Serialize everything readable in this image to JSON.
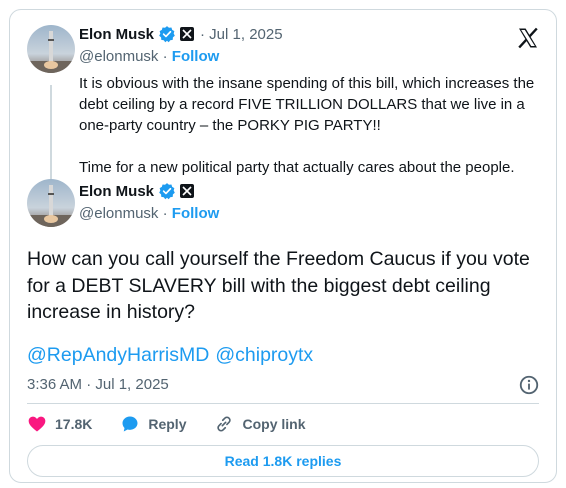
{
  "quoted_tweet": {
    "author_name": "Elon Musk",
    "date": "· Jul 1, 2025",
    "handle": "@elonmusk",
    "follow_sep": " · ",
    "follow_label": "Follow",
    "text": "It is obvious with the insane spending of this bill, which increases the debt ceiling by a record FIVE TRILLION DOLLARS that we live in a one-party country – the PORKY PIG PARTY!!\n\nTime for a new political party that actually cares about the people."
  },
  "main_tweet": {
    "author_name": "Elon Musk",
    "handle": "@elonmusk",
    "follow_sep": " · ",
    "follow_label": "Follow",
    "text": "How can you call yourself the Freedom Caucus if you vote for a DEBT SLAVERY bill with the biggest debt ceiling increase in history?",
    "mentions": [
      "@RepAndyHarrisMD",
      "@chiproytx"
    ],
    "timestamp": "3:36 AM · Jul 1, 2025"
  },
  "actions": {
    "likes": "17.8K",
    "reply_label": "Reply",
    "copy_link_label": "Copy link"
  },
  "read_replies_label": "Read 1.8K replies",
  "colors": {
    "accent": "#1d9bf0",
    "like": "#f91880",
    "text": "#0f1419",
    "muted": "#536471"
  }
}
